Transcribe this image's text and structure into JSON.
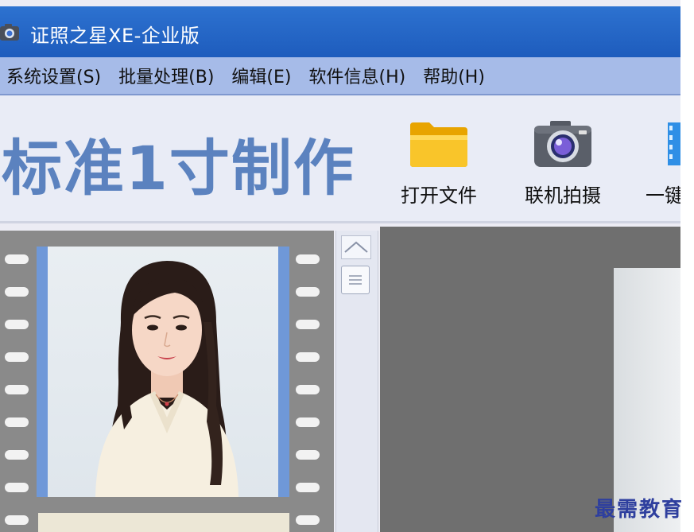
{
  "window": {
    "title": "证照之星XE-企业版"
  },
  "menu": {
    "items": [
      {
        "id": "system",
        "label": "系统设置(S)"
      },
      {
        "id": "batch",
        "label": "批量处理(B)"
      },
      {
        "id": "edit",
        "label": "编辑(E)"
      },
      {
        "id": "software",
        "label": "软件信息(H)"
      },
      {
        "id": "help",
        "label": "帮助(H)"
      }
    ]
  },
  "toolbar": {
    "heading": "标准1寸制作",
    "open_file": {
      "label": "打开文件",
      "icon": "folder-icon"
    },
    "camera_capture": {
      "label": "联机拍摄",
      "icon": "camera-icon"
    },
    "one_click": {
      "label": "一键",
      "icon": "film-icon"
    }
  },
  "colors": {
    "titlebar": "#2468c8",
    "menubar": "#a6bbe8",
    "heading": "#5b82bf",
    "film": "#8a8a8a",
    "preview": "#6f6f6f"
  },
  "watermark": {
    "text": "最需教育"
  }
}
